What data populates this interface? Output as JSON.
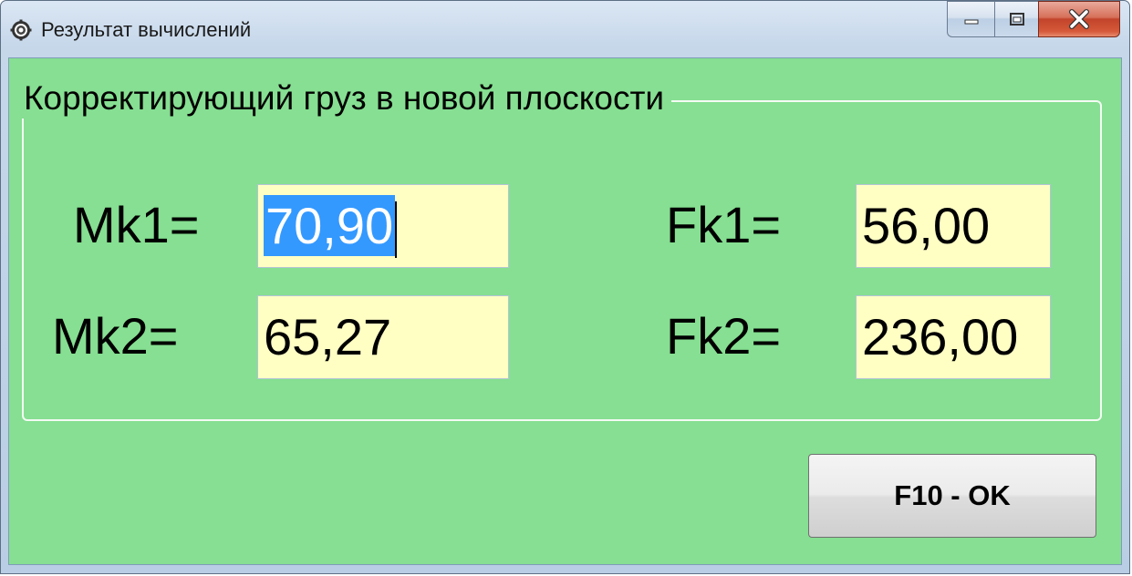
{
  "window": {
    "title": "Результат вычислений",
    "app_icon": "gear-icon",
    "controls": [
      "minimize-icon",
      "maximize-icon",
      "close-icon"
    ]
  },
  "group": {
    "caption": "Корректирующий груз в новой плоскости"
  },
  "fields": {
    "mk1": {
      "label": "Mk1=",
      "value": "70,90"
    },
    "mk2": {
      "label": "Mk2=",
      "value": "65,27"
    },
    "fk1": {
      "label": "Fk1=",
      "value": "56,00"
    },
    "fk2": {
      "label": "Fk2=",
      "value": "236,00"
    }
  },
  "ok_button": {
    "label": "F10 - OK"
  },
  "colors": {
    "client_bg": "#86df92",
    "field_bg": "#ffffc4",
    "selection": "#3399ff",
    "close_button": "#c2432a"
  }
}
